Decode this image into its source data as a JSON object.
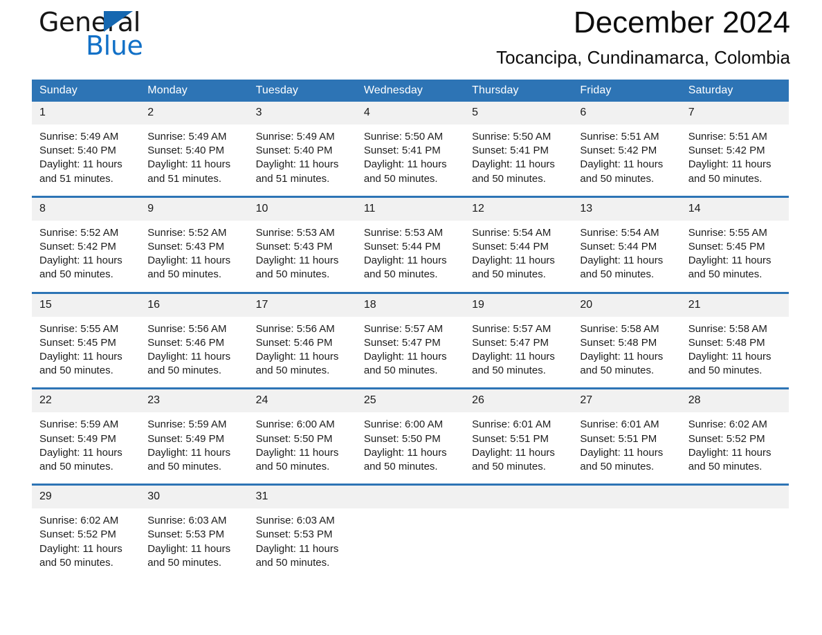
{
  "brand": {
    "name_part1": "General",
    "name_part2": "Blue",
    "triangle_color": "#1567b0",
    "blue_color": "#1170c7"
  },
  "header": {
    "title": "December 2024",
    "subtitle": "Tocancipa, Cundinamarca, Colombia"
  },
  "theme": {
    "header_blue": "#2d74b5",
    "row_divider_blue": "#2d74b5",
    "daynum_band": "#f1f1f1",
    "page_background": "#ffffff",
    "text": "#1a1a1a"
  },
  "weekdays": [
    "Sunday",
    "Monday",
    "Tuesday",
    "Wednesday",
    "Thursday",
    "Friday",
    "Saturday"
  ],
  "labels": {
    "sunrise_prefix": "Sunrise:",
    "sunset_prefix": "Sunset:",
    "daylight_prefix": "Daylight:"
  },
  "weeks": [
    [
      {
        "day": "1",
        "sunrise": "Sunrise: 5:49 AM",
        "sunset": "Sunset: 5:40 PM",
        "daylight_line1": "Daylight: 11 hours",
        "daylight_line2": "and 51 minutes."
      },
      {
        "day": "2",
        "sunrise": "Sunrise: 5:49 AM",
        "sunset": "Sunset: 5:40 PM",
        "daylight_line1": "Daylight: 11 hours",
        "daylight_line2": "and 51 minutes."
      },
      {
        "day": "3",
        "sunrise": "Sunrise: 5:49 AM",
        "sunset": "Sunset: 5:40 PM",
        "daylight_line1": "Daylight: 11 hours",
        "daylight_line2": "and 51 minutes."
      },
      {
        "day": "4",
        "sunrise": "Sunrise: 5:50 AM",
        "sunset": "Sunset: 5:41 PM",
        "daylight_line1": "Daylight: 11 hours",
        "daylight_line2": "and 50 minutes."
      },
      {
        "day": "5",
        "sunrise": "Sunrise: 5:50 AM",
        "sunset": "Sunset: 5:41 PM",
        "daylight_line1": "Daylight: 11 hours",
        "daylight_line2": "and 50 minutes."
      },
      {
        "day": "6",
        "sunrise": "Sunrise: 5:51 AM",
        "sunset": "Sunset: 5:42 PM",
        "daylight_line1": "Daylight: 11 hours",
        "daylight_line2": "and 50 minutes."
      },
      {
        "day": "7",
        "sunrise": "Sunrise: 5:51 AM",
        "sunset": "Sunset: 5:42 PM",
        "daylight_line1": "Daylight: 11 hours",
        "daylight_line2": "and 50 minutes."
      }
    ],
    [
      {
        "day": "8",
        "sunrise": "Sunrise: 5:52 AM",
        "sunset": "Sunset: 5:42 PM",
        "daylight_line1": "Daylight: 11 hours",
        "daylight_line2": "and 50 minutes."
      },
      {
        "day": "9",
        "sunrise": "Sunrise: 5:52 AM",
        "sunset": "Sunset: 5:43 PM",
        "daylight_line1": "Daylight: 11 hours",
        "daylight_line2": "and 50 minutes."
      },
      {
        "day": "10",
        "sunrise": "Sunrise: 5:53 AM",
        "sunset": "Sunset: 5:43 PM",
        "daylight_line1": "Daylight: 11 hours",
        "daylight_line2": "and 50 minutes."
      },
      {
        "day": "11",
        "sunrise": "Sunrise: 5:53 AM",
        "sunset": "Sunset: 5:44 PM",
        "daylight_line1": "Daylight: 11 hours",
        "daylight_line2": "and 50 minutes."
      },
      {
        "day": "12",
        "sunrise": "Sunrise: 5:54 AM",
        "sunset": "Sunset: 5:44 PM",
        "daylight_line1": "Daylight: 11 hours",
        "daylight_line2": "and 50 minutes."
      },
      {
        "day": "13",
        "sunrise": "Sunrise: 5:54 AM",
        "sunset": "Sunset: 5:44 PM",
        "daylight_line1": "Daylight: 11 hours",
        "daylight_line2": "and 50 minutes."
      },
      {
        "day": "14",
        "sunrise": "Sunrise: 5:55 AM",
        "sunset": "Sunset: 5:45 PM",
        "daylight_line1": "Daylight: 11 hours",
        "daylight_line2": "and 50 minutes."
      }
    ],
    [
      {
        "day": "15",
        "sunrise": "Sunrise: 5:55 AM",
        "sunset": "Sunset: 5:45 PM",
        "daylight_line1": "Daylight: 11 hours",
        "daylight_line2": "and 50 minutes."
      },
      {
        "day": "16",
        "sunrise": "Sunrise: 5:56 AM",
        "sunset": "Sunset: 5:46 PM",
        "daylight_line1": "Daylight: 11 hours",
        "daylight_line2": "and 50 minutes."
      },
      {
        "day": "17",
        "sunrise": "Sunrise: 5:56 AM",
        "sunset": "Sunset: 5:46 PM",
        "daylight_line1": "Daylight: 11 hours",
        "daylight_line2": "and 50 minutes."
      },
      {
        "day": "18",
        "sunrise": "Sunrise: 5:57 AM",
        "sunset": "Sunset: 5:47 PM",
        "daylight_line1": "Daylight: 11 hours",
        "daylight_line2": "and 50 minutes."
      },
      {
        "day": "19",
        "sunrise": "Sunrise: 5:57 AM",
        "sunset": "Sunset: 5:47 PM",
        "daylight_line1": "Daylight: 11 hours",
        "daylight_line2": "and 50 minutes."
      },
      {
        "day": "20",
        "sunrise": "Sunrise: 5:58 AM",
        "sunset": "Sunset: 5:48 PM",
        "daylight_line1": "Daylight: 11 hours",
        "daylight_line2": "and 50 minutes."
      },
      {
        "day": "21",
        "sunrise": "Sunrise: 5:58 AM",
        "sunset": "Sunset: 5:48 PM",
        "daylight_line1": "Daylight: 11 hours",
        "daylight_line2": "and 50 minutes."
      }
    ],
    [
      {
        "day": "22",
        "sunrise": "Sunrise: 5:59 AM",
        "sunset": "Sunset: 5:49 PM",
        "daylight_line1": "Daylight: 11 hours",
        "daylight_line2": "and 50 minutes."
      },
      {
        "day": "23",
        "sunrise": "Sunrise: 5:59 AM",
        "sunset": "Sunset: 5:49 PM",
        "daylight_line1": "Daylight: 11 hours",
        "daylight_line2": "and 50 minutes."
      },
      {
        "day": "24",
        "sunrise": "Sunrise: 6:00 AM",
        "sunset": "Sunset: 5:50 PM",
        "daylight_line1": "Daylight: 11 hours",
        "daylight_line2": "and 50 minutes."
      },
      {
        "day": "25",
        "sunrise": "Sunrise: 6:00 AM",
        "sunset": "Sunset: 5:50 PM",
        "daylight_line1": "Daylight: 11 hours",
        "daylight_line2": "and 50 minutes."
      },
      {
        "day": "26",
        "sunrise": "Sunrise: 6:01 AM",
        "sunset": "Sunset: 5:51 PM",
        "daylight_line1": "Daylight: 11 hours",
        "daylight_line2": "and 50 minutes."
      },
      {
        "day": "27",
        "sunrise": "Sunrise: 6:01 AM",
        "sunset": "Sunset: 5:51 PM",
        "daylight_line1": "Daylight: 11 hours",
        "daylight_line2": "and 50 minutes."
      },
      {
        "day": "28",
        "sunrise": "Sunrise: 6:02 AM",
        "sunset": "Sunset: 5:52 PM",
        "daylight_line1": "Daylight: 11 hours",
        "daylight_line2": "and 50 minutes."
      }
    ],
    [
      {
        "day": "29",
        "sunrise": "Sunrise: 6:02 AM",
        "sunset": "Sunset: 5:52 PM",
        "daylight_line1": "Daylight: 11 hours",
        "daylight_line2": "and 50 minutes."
      },
      {
        "day": "30",
        "sunrise": "Sunrise: 6:03 AM",
        "sunset": "Sunset: 5:53 PM",
        "daylight_line1": "Daylight: 11 hours",
        "daylight_line2": "and 50 minutes."
      },
      {
        "day": "31",
        "sunrise": "Sunrise: 6:03 AM",
        "sunset": "Sunset: 5:53 PM",
        "daylight_line1": "Daylight: 11 hours",
        "daylight_line2": "and 50 minutes."
      },
      {
        "day": "",
        "sunrise": "",
        "sunset": "",
        "daylight_line1": "",
        "daylight_line2": ""
      },
      {
        "day": "",
        "sunrise": "",
        "sunset": "",
        "daylight_line1": "",
        "daylight_line2": ""
      },
      {
        "day": "",
        "sunrise": "",
        "sunset": "",
        "daylight_line1": "",
        "daylight_line2": ""
      },
      {
        "day": "",
        "sunrise": "",
        "sunset": "",
        "daylight_line1": "",
        "daylight_line2": ""
      }
    ]
  ]
}
